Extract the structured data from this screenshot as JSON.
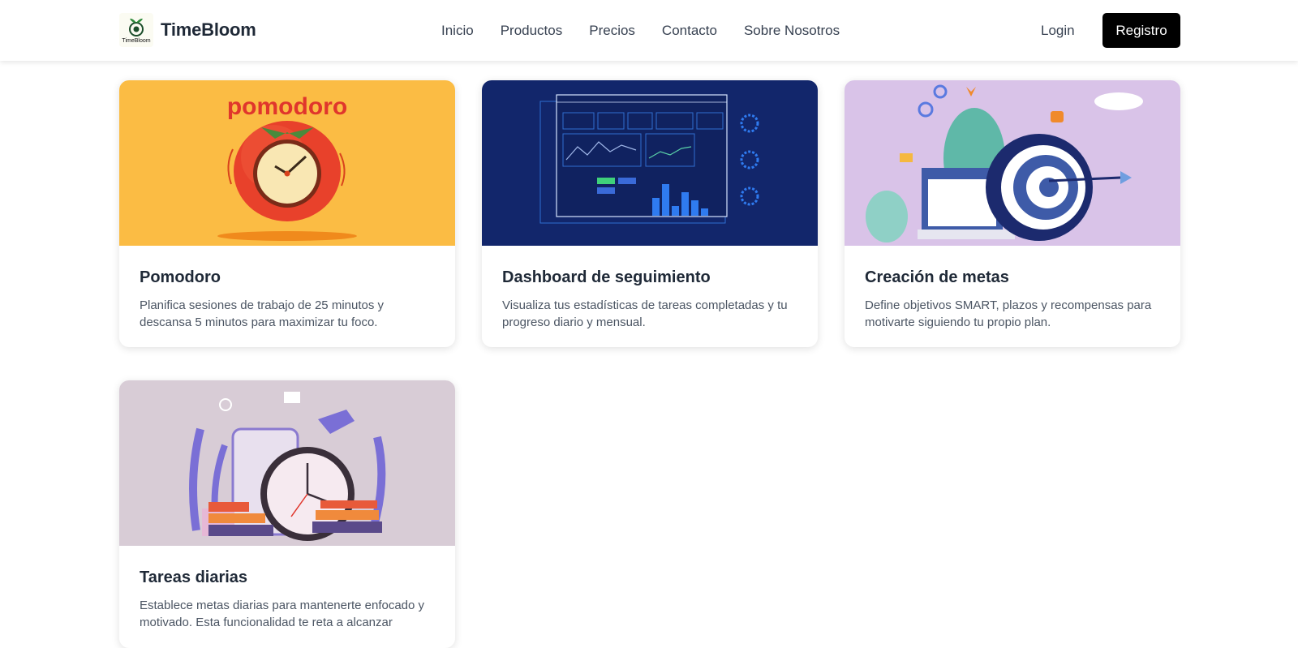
{
  "brand": {
    "name": "TimeBloom",
    "logo_text": "TimeBloom"
  },
  "nav": {
    "items": [
      "Inicio",
      "Productos",
      "Precios",
      "Contacto",
      "Sobre Nosotros"
    ]
  },
  "auth": {
    "login_label": "Login",
    "register_label": "Registro"
  },
  "cards": [
    {
      "title": "Pomodoro",
      "description": "Planifica sesiones de trabajo de 25 minutos y descansa 5 minutos para maximizar tu foco.",
      "image_text": "pomodoro"
    },
    {
      "title": "Dashboard de seguimiento",
      "description": "Visualiza tus estadísticas de tareas completadas y tu progreso diario y mensual.",
      "image_text": ""
    },
    {
      "title": "Creación de metas",
      "description": "Define objetivos SMART, plazos y recompensas para motivarte siguiendo tu propio plan.",
      "image_text": ""
    },
    {
      "title": "Tareas diarias",
      "description": "Establece metas diarias para mantenerte enfocado y motivado. Esta funcionalidad te reta a alcanzar",
      "image_text": ""
    }
  ],
  "colors": {
    "register_bg": "#000000",
    "pomodoro_bg": "#fbbc44",
    "dashboard_bg": "#12266b",
    "metas_bg": "#d9c3e8",
    "tareas_bg": "#d8ccd6"
  },
  "icons": [
    "sprout-logo-icon"
  ]
}
